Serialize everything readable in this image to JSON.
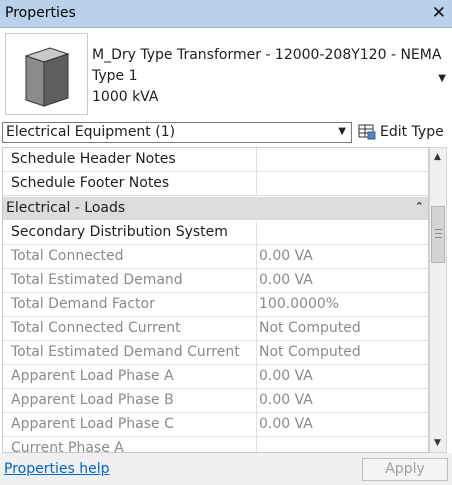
{
  "window": {
    "title": "Properties"
  },
  "type_selector": {
    "family": "M_Dry Type Transformer - 12000-208Y120 - NEMA",
    "type": "Type 1",
    "rating": "1000 kVA"
  },
  "category_selector": {
    "value": "Electrical Equipment (1)"
  },
  "edit_type_label": "Edit Type",
  "rows": [
    {
      "name": "Schedule Header Notes",
      "value": ""
    },
    {
      "name": "Schedule Footer Notes",
      "value": ""
    }
  ],
  "group": {
    "name": "Electrical - Loads"
  },
  "rows2": [
    {
      "name": "Secondary Distribution System",
      "value": ""
    },
    {
      "name": "Total Connected",
      "value": "0.00 VA"
    },
    {
      "name": "Total Estimated Demand",
      "value": "0.00 VA"
    },
    {
      "name": "Total Demand Factor",
      "value": "100.0000%"
    },
    {
      "name": "Total Connected Current",
      "value": "Not Computed"
    },
    {
      "name": "Total Estimated Demand Current",
      "value": "Not Computed"
    },
    {
      "name": "Apparent Load Phase A",
      "value": "0.00 VA"
    },
    {
      "name": "Apparent Load Phase B",
      "value": "0.00 VA"
    },
    {
      "name": "Apparent Load Phase C",
      "value": "0.00 VA"
    },
    {
      "name": "Current Phase A",
      "value": ""
    }
  ],
  "footer": {
    "help_link": "Properties help",
    "apply_label": "Apply"
  }
}
